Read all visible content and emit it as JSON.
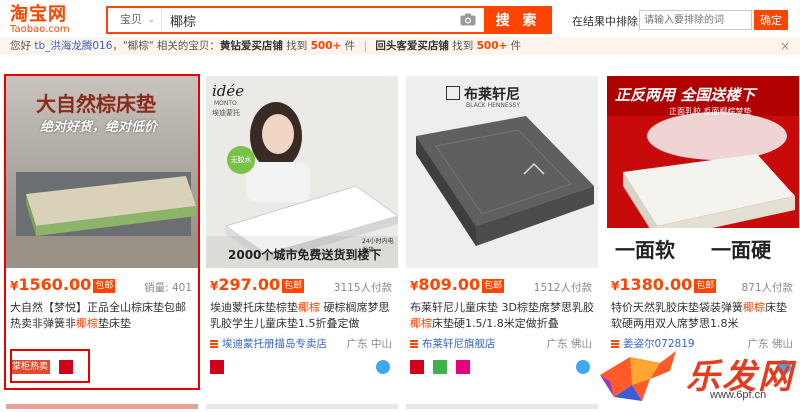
{
  "header": {
    "logo_cn": "淘宝网",
    "logo_en": "Taobao.com",
    "search_type": "宝贝",
    "search_value": "椰棕",
    "search_button": "搜 索",
    "in_result_label": "在结果中排除",
    "in_result_placeholder": "请输入要排除的词",
    "confirm_button": "确定"
  },
  "tip": {
    "prefix": "您好",
    "user": "tb_洪海龙腾016",
    "mid1": "，\"椰棕\" 相关的宝贝：",
    "shop1": "黄钻爱买店铺",
    "found1": "找到",
    "count1": "500+",
    "unit1": "件",
    "sep": "|",
    "shop2": "回头客爱买店铺",
    "found2": "找到",
    "count2": "500+",
    "unit2": "件",
    "close": "×"
  },
  "products": [
    {
      "banner_main": "大自然棕床垫",
      "banner_sub": "绝对好货，绝对低价",
      "currency": "¥",
      "price": "1560.00",
      "baoyou": "包邮",
      "sold": "销量: 401",
      "title_pre": "大自然【梦悦】正品全山棕床垫包邮热卖非弹簧非",
      "title_kw": "椰棕",
      "title_post": "垫床垫",
      "badge_label": "掌柜热卖"
    },
    {
      "brand": "idée",
      "brand_sub": "MONTO",
      "brand_cn": "埃迪蒙托",
      "tag": "无胶水",
      "banner_bottom": "2000个城市免费送货到楼下",
      "banner_small": "24小时内电发货",
      "currency": "¥",
      "price": "297.00",
      "baoyou": "包邮",
      "sold": "3115人付款",
      "title_pre": "埃迪蒙托床垫棕垫",
      "title_kw": "椰棕",
      "title_post": " 硬棕榈席梦思乳胶学生儿童床垫1.5折叠定做",
      "shop": "埃迪蒙托册描岛专卖店",
      "loc": "广东 中山"
    },
    {
      "brand_cn": "布莱轩尼",
      "brand_en": "BLACK HENNESSY",
      "currency": "¥",
      "price": "809.00",
      "baoyou": "包邮",
      "sold": "1512人付款",
      "title_pre": "布莱轩尼儿童床垫 3D棕垫席梦思乳胶",
      "title_kw": "椰棕",
      "title_post": "床垫硬1.5/1.8米定做折叠",
      "shop": "布莱轩尼旗舰店",
      "loc": "广东 佛山"
    },
    {
      "banner_top": "正反两用 全国送楼下",
      "banner_sub": "正面乳胶 反面椰棕梦垫",
      "banner_left": "一面软",
      "banner_right": "一面硬",
      "currency": "¥",
      "price": "1380.00",
      "baoyou": "包邮",
      "sold": "871人付款",
      "title_pre": "特价天然乳胶床垫袋装弹簧",
      "title_kw": "椰棕",
      "title_post": "床垫软硬两用双人席梦思1.8米",
      "shop": "姜姿尔072819",
      "loc": "广东 佛山"
    }
  ],
  "watermark": {
    "text": "乐发网",
    "url": "www.6pf.cn"
  },
  "colors": {
    "accent": "#ff4400",
    "select_red": "#e60000",
    "link": "#3366cc"
  }
}
